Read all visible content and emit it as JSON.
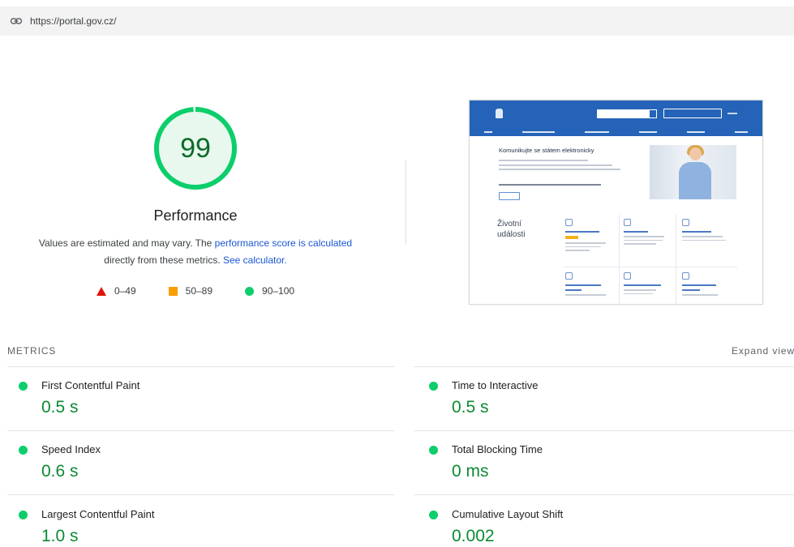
{
  "url_bar": {
    "icon": "link-icon",
    "url": "https://portal.gov.cz/"
  },
  "score": {
    "value": "99",
    "fraction": 0.99,
    "category": "Performance",
    "color": "#0cce6b",
    "bg_color": "#e8f8ee",
    "text_color": "#0c6b27"
  },
  "description": {
    "text1": "Values are estimated and may vary. The ",
    "link1": "performance score is calculated",
    "text2": "directly from these metrics. ",
    "link2": "See calculator."
  },
  "legend": [
    {
      "shape": "triangle",
      "range": "0–49",
      "color": "#e2140a"
    },
    {
      "shape": "square",
      "range": "50–89",
      "color": "#f79e00"
    },
    {
      "shape": "circle",
      "range": "90–100",
      "color": "#0cce6b"
    }
  ],
  "screenshot_preview": {
    "hero_title": "Komunikujte se státem elektronicky",
    "life_events_title": "Životní\nudálosti"
  },
  "metrics": {
    "section_label": "METRICS",
    "expand_label": "Expand view",
    "items": [
      {
        "name": "First Contentful Paint",
        "value": "0.5 s",
        "status_color": "#0cce6b"
      },
      {
        "name": "Time to Interactive",
        "value": "0.5 s",
        "status_color": "#0cce6b"
      },
      {
        "name": "Speed Index",
        "value": "0.6 s",
        "status_color": "#0cce6b"
      },
      {
        "name": "Total Blocking Time",
        "value": "0 ms",
        "status_color": "#0cce6b"
      },
      {
        "name": "Largest Contentful Paint",
        "value": "1.0 s",
        "status_color": "#0cce6b"
      },
      {
        "name": "Cumulative Layout Shift",
        "value": "0.002",
        "status_color": "#0cce6b"
      }
    ]
  }
}
